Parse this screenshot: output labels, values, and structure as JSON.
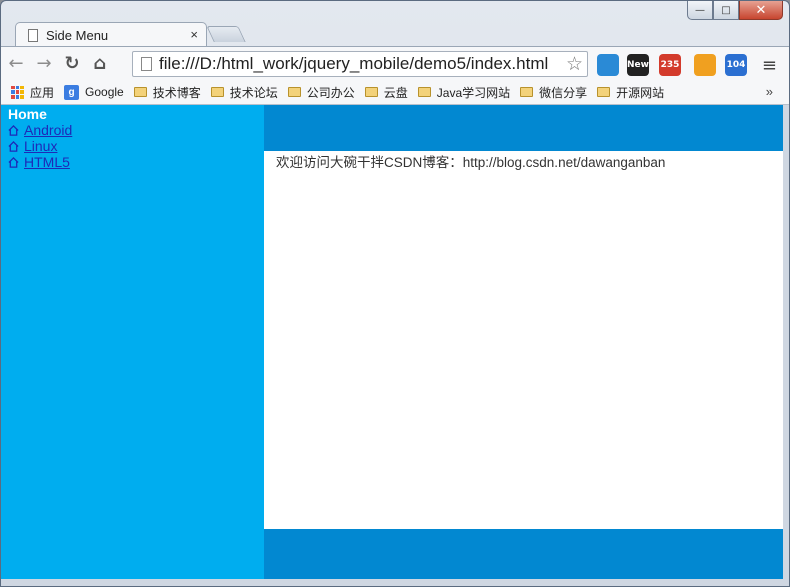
{
  "window": {
    "minimize_glyph": "—",
    "maximize_glyph": "□",
    "close_glyph": "✕"
  },
  "tabs": [
    {
      "label": "Side Menu",
      "close_glyph": "×"
    }
  ],
  "toolbar": {
    "back_glyph": "←",
    "forward_glyph": "→",
    "reload_glyph": "↻",
    "home_glyph": "⌂",
    "url": "file:///D:/html_work/jquery_mobile/demo5/index.html",
    "star_glyph": "☆",
    "menu_glyph": "≡",
    "extensions": [
      {
        "name": "calendar-extension-icon",
        "color": "#2a8ad6",
        "badge": ""
      },
      {
        "name": "speed-extension-icon",
        "color": "#222222",
        "badge": "New"
      },
      {
        "name": "mail-extension-icon",
        "color": "#d33b2c",
        "badge": "235"
      },
      {
        "name": "weather-extension-icon",
        "color": "#f0a020",
        "badge": ""
      },
      {
        "name": "notes-extension-icon",
        "color": "#2b6fd1",
        "badge": "104"
      }
    ]
  },
  "bookmarks": {
    "items": [
      {
        "label": "应用",
        "type": "apps"
      },
      {
        "label": "Google",
        "type": "google"
      },
      {
        "label": "技术博客",
        "type": "folder"
      },
      {
        "label": "技术论坛",
        "type": "folder"
      },
      {
        "label": "公司办公",
        "type": "folder"
      },
      {
        "label": "云盘",
        "type": "folder"
      },
      {
        "label": "Java学习网站",
        "type": "folder"
      },
      {
        "label": "微信分享",
        "type": "folder"
      },
      {
        "label": "开源网站",
        "type": "folder"
      }
    ],
    "overflow_glyph": "»"
  },
  "page": {
    "sidebar": {
      "title": "Home",
      "items": [
        {
          "label": "Android"
        },
        {
          "label": "Linux"
        },
        {
          "label": "HTML5"
        }
      ]
    },
    "content_text": "欢迎访问大碗干拌CSDN博客：http://blog.csdn.net/dawanganban",
    "watermark": "http://blog.csdn.net/dawanganban"
  },
  "colors": {
    "sidebar_bg": "#00adef",
    "header_bg": "#0288d1",
    "link": "#1d2ab8"
  }
}
